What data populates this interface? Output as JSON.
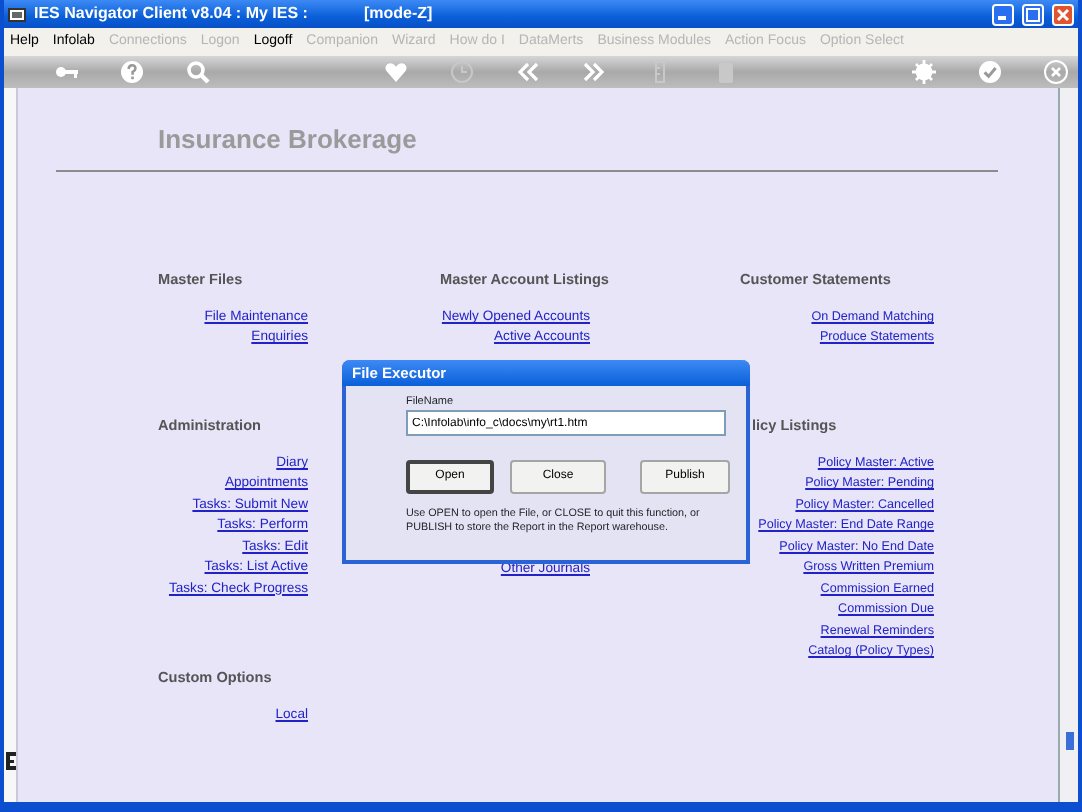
{
  "window": {
    "title": "IES Navigator Client v8.04 : My IES :",
    "mode": "[mode-Z]"
  },
  "menu": [
    {
      "label": "Help",
      "disabled": false
    },
    {
      "label": "Infolab",
      "disabled": false
    },
    {
      "label": "Connections",
      "disabled": true
    },
    {
      "label": "Logon",
      "disabled": true
    },
    {
      "label": "Logoff",
      "disabled": false
    },
    {
      "label": "Companion",
      "disabled": true
    },
    {
      "label": "Wizard",
      "disabled": true
    },
    {
      "label": "How do I",
      "disabled": true
    },
    {
      "label": "DataMerts",
      "disabled": true
    },
    {
      "label": "Business Modules",
      "disabled": true
    },
    {
      "label": "Action Focus",
      "disabled": true
    },
    {
      "label": "Option Select",
      "disabled": true
    }
  ],
  "toolbar": [
    [
      {
        "kind": "key",
        "disabled": false
      },
      {
        "kind": "help",
        "disabled": false
      },
      {
        "kind": "search",
        "disabled": false
      }
    ],
    [
      {
        "kind": "heart",
        "disabled": false
      },
      {
        "kind": "clock",
        "disabled": true
      },
      {
        "kind": "back",
        "disabled": false
      },
      {
        "kind": "forward",
        "disabled": false
      },
      {
        "kind": "ruler",
        "disabled": true
      },
      {
        "kind": "clipboard",
        "disabled": true
      }
    ],
    [
      {
        "kind": "gear",
        "disabled": false
      },
      {
        "kind": "check",
        "disabled": false
      },
      {
        "kind": "close",
        "disabled": false
      }
    ]
  ],
  "page": {
    "heading": "Insurance Brokerage",
    "rows": [
      [
        {
          "heading": "Master Files",
          "links": [
            "File Maintenance",
            "Enquiries"
          ]
        },
        {
          "heading": "Master Account Listings",
          "links": [
            "Newly Opened Accounts",
            "Active Accounts"
          ]
        },
        {
          "heading": "Customer Statements",
          "links": [
            "On Demand Matching",
            "Produce Statements"
          ]
        }
      ],
      [
        {
          "heading": "Administration",
          "links": [
            "Diary",
            "Appointments",
            "Tasks: Submit New",
            "Tasks: Perform",
            "Tasks: Edit",
            "Tasks: List Active",
            "Tasks: Check Progress"
          ]
        },
        {
          "links": [
            "Other Journals"
          ]
        },
        {
          "heading": "licy Listings",
          "links": [
            "Policy Master: Active",
            "Policy Master: Pending",
            "Policy Master: Cancelled",
            "Policy Master: End Date Range",
            "Policy Master: No End Date",
            "Gross Written Premium",
            "Commission Earned",
            "Commission Due",
            "Renewal Reminders",
            "Catalog (Policy Types)"
          ]
        }
      ],
      [
        {
          "heading": "Custom Options",
          "links": [
            "Local"
          ]
        }
      ]
    ]
  },
  "dialog": {
    "title": "File Executor",
    "field_label": "FileName",
    "value": "C:\\Infolab\\info_c\\docs\\my\\rt1.htm",
    "buttons": [
      {
        "label": "Open",
        "selected": true
      },
      {
        "label": "Close",
        "selected": false
      },
      {
        "label": "Publish",
        "selected": false
      }
    ],
    "note": "Use OPEN to open the File, or CLOSE to quit this function, or\nPUBLISH to store the Report in the Report warehouse."
  }
}
